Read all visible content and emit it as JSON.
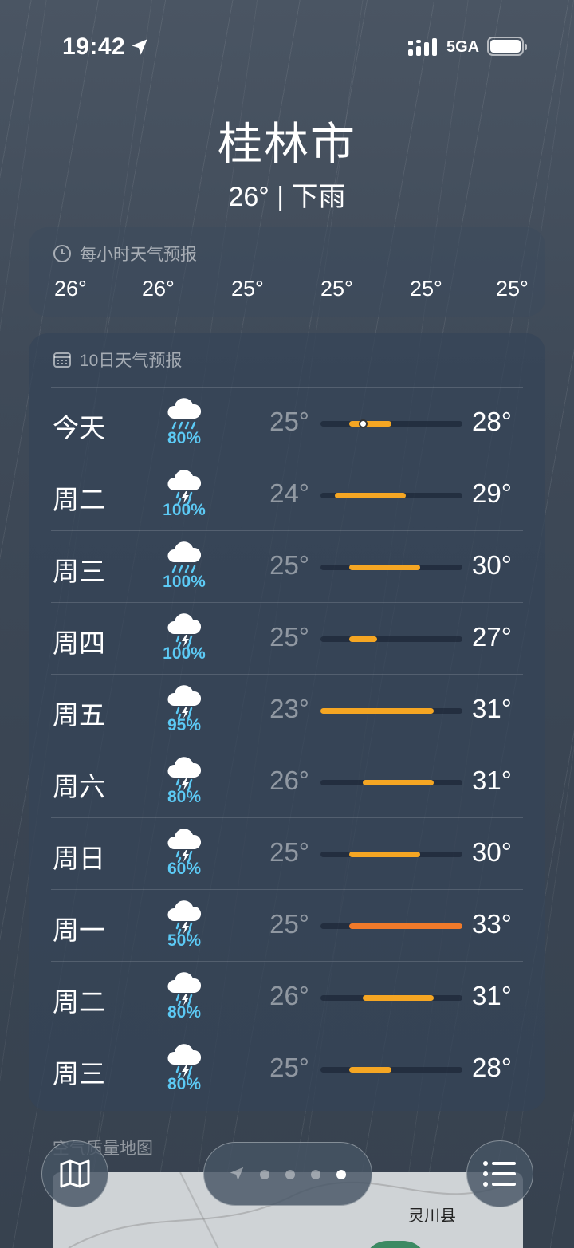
{
  "status_bar": {
    "time": "19:42",
    "network": "5GA"
  },
  "header": {
    "city": "桂林市",
    "subtitle": "26° | 下雨"
  },
  "hourly": {
    "title": "每小时天气预报",
    "temps": [
      "26°",
      "26°",
      "25°",
      "25°",
      "25°",
      "25°"
    ]
  },
  "daily": {
    "title": "10日天气预报",
    "scale": {
      "min": 23,
      "max": 33
    },
    "days": [
      {
        "name": "今天",
        "icon": "rain-cloud-icon",
        "precip": "80%",
        "low": "25°",
        "high": "28°",
        "low_val": 25,
        "high_val": 28,
        "current": 26,
        "color": "#f5a623"
      },
      {
        "name": "周二",
        "icon": "thunderstorm-icon",
        "precip": "100%",
        "low": "24°",
        "high": "29°",
        "low_val": 24,
        "high_val": 29,
        "color": "#f5a623"
      },
      {
        "name": "周三",
        "icon": "rain-cloud-icon",
        "precip": "100%",
        "low": "25°",
        "high": "30°",
        "low_val": 25,
        "high_val": 30,
        "color": "#f5a623"
      },
      {
        "name": "周四",
        "icon": "thunderstorm-icon",
        "precip": "100%",
        "low": "25°",
        "high": "27°",
        "low_val": 25,
        "high_val": 27,
        "color": "#f5a623"
      },
      {
        "name": "周五",
        "icon": "thunderstorm-icon",
        "precip": "95%",
        "low": "23°",
        "high": "31°",
        "low_val": 23,
        "high_val": 31,
        "color": "#f5a623"
      },
      {
        "name": "周六",
        "icon": "thunderstorm-icon",
        "precip": "80%",
        "low": "26°",
        "high": "31°",
        "low_val": 26,
        "high_val": 31,
        "color": "#f5a623"
      },
      {
        "name": "周日",
        "icon": "thunderstorm-icon",
        "precip": "60%",
        "low": "25°",
        "high": "30°",
        "low_val": 25,
        "high_val": 30,
        "color": "#f5a623"
      },
      {
        "name": "周一",
        "icon": "thunderstorm-icon",
        "precip": "50%",
        "low": "25°",
        "high": "33°",
        "low_val": 25,
        "high_val": 33,
        "color": "#f07a2a"
      },
      {
        "name": "周二",
        "icon": "thunderstorm-icon",
        "precip": "80%",
        "low": "26°",
        "high": "31°",
        "low_val": 26,
        "high_val": 31,
        "color": "#f5a623"
      },
      {
        "name": "周三",
        "icon": "thunderstorm-icon",
        "precip": "80%",
        "low": "25°",
        "high": "28°",
        "low_val": 25,
        "high_val": 28,
        "color": "#f5a623"
      }
    ]
  },
  "air_quality": {
    "title": "空气质量地图",
    "map_label": "灵川县"
  },
  "toolbar": {
    "page_count": 4,
    "active_page": 4
  }
}
